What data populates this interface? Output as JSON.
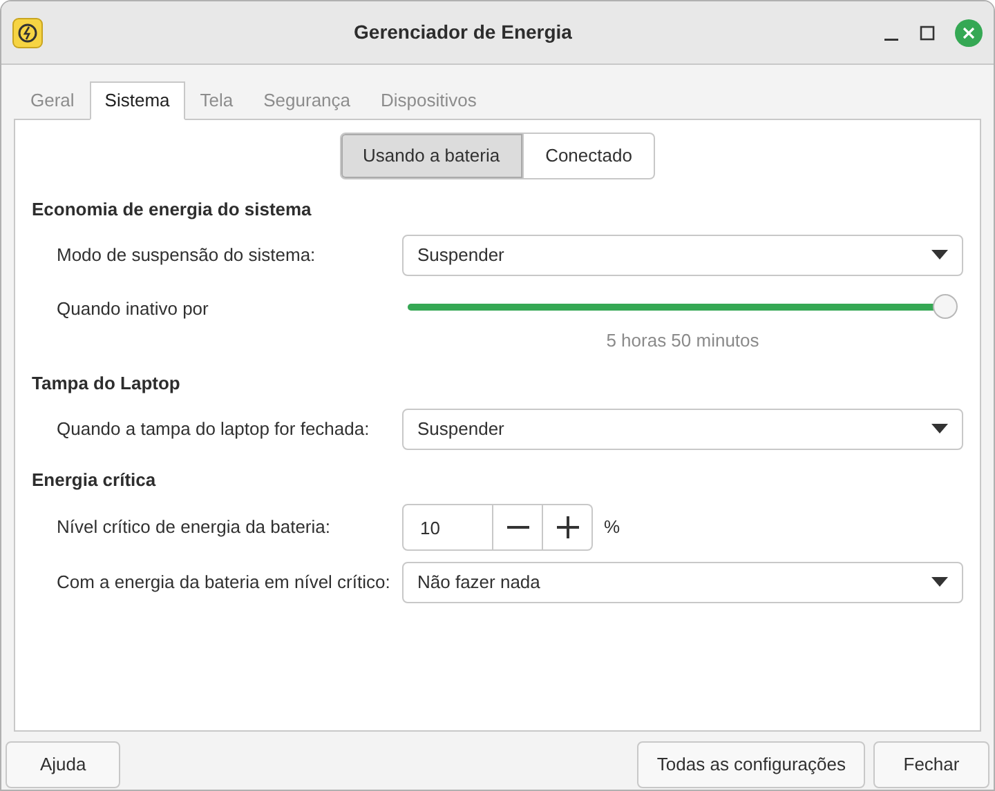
{
  "window": {
    "title": "Gerenciador de Energia"
  },
  "tabs": [
    {
      "label": "Geral",
      "selected": false
    },
    {
      "label": "Sistema",
      "selected": true
    },
    {
      "label": "Tela",
      "selected": false
    },
    {
      "label": "Segurança",
      "selected": false
    },
    {
      "label": "Dispositivos",
      "selected": false
    }
  ],
  "mode_toggle": [
    {
      "label": "Usando a bateria",
      "selected": true
    },
    {
      "label": "Conectado",
      "selected": false
    }
  ],
  "sections": [
    {
      "title": "Economia de energia do sistema",
      "rows": [
        {
          "kind": "dropdown",
          "label": "Modo de suspensão do sistema:",
          "value": "Suspender"
        },
        {
          "kind": "slider",
          "label": "Quando inativo por",
          "level": 0.99,
          "reading": "5 horas 50 minutos"
        }
      ]
    },
    {
      "title": "Tampa do Laptop",
      "rows": [
        {
          "kind": "dropdown",
          "label": "Quando a tampa do laptop for fechada:",
          "value": "Suspender"
        }
      ]
    },
    {
      "title": "Energia crítica",
      "rows": [
        {
          "kind": "spin",
          "label": "Nível crítico de energia da bateria:",
          "value": "10",
          "unit": "%"
        },
        {
          "kind": "dropdown",
          "label": "Com a energia da bateria em nível crítico:",
          "value": "Não fazer nada"
        }
      ]
    }
  ],
  "footer": {
    "left": [
      "Ajuda"
    ],
    "right": [
      "Todas as configurações",
      "Fechar"
    ]
  }
}
